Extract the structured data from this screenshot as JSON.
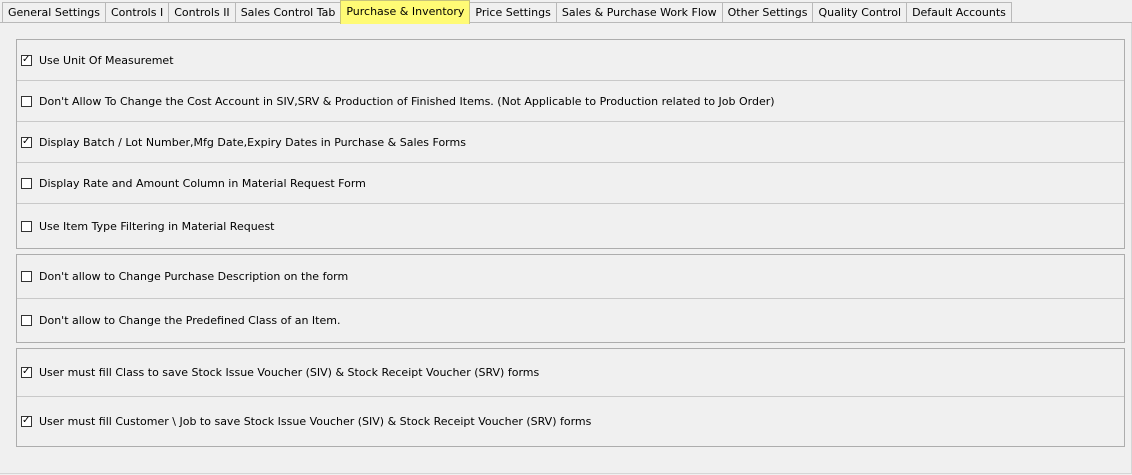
{
  "tabs": [
    {
      "label": "General Settings",
      "active": false
    },
    {
      "label": "Controls I",
      "active": false
    },
    {
      "label": "Controls II",
      "active": false
    },
    {
      "label": "Sales Control Tab",
      "active": false
    },
    {
      "label": "Purchase & Inventory",
      "active": true
    },
    {
      "label": "Price Settings",
      "active": false
    },
    {
      "label": "Sales & Purchase Work Flow",
      "active": false
    },
    {
      "label": "Other Settings",
      "active": false
    },
    {
      "label": "Quality Control",
      "active": false
    },
    {
      "label": "Default Accounts",
      "active": false
    }
  ],
  "group1": [
    {
      "label": "Use Unit Of Measuremet",
      "checked": true
    },
    {
      "label": "Don't Allow To Change the Cost Account in SIV,SRV & Production of Finished Items. (Not Applicable to Production related to Job Order)",
      "checked": false
    },
    {
      "label": "Display Batch / Lot Number,Mfg Date,Expiry Dates in Purchase & Sales Forms",
      "checked": true
    },
    {
      "label": "Display Rate and Amount Column in Material Request Form",
      "checked": false
    },
    {
      "label": "Use Item Type Filtering in Material Request",
      "checked": false
    }
  ],
  "group2": [
    {
      "label": "Don't allow to Change Purchase Description  on the form",
      "checked": false
    },
    {
      "label": "Don't allow to Change the Predefined Class of an Item.",
      "checked": false
    }
  ],
  "group3": [
    {
      "label": "User must fill Class to save Stock Issue Voucher (SIV) & Stock Receipt Voucher (SRV) forms",
      "checked": true
    },
    {
      "label": "User must fill Customer \\ Job to save Stock Issue Voucher (SIV) & Stock Receipt Voucher (SRV) forms",
      "checked": true
    }
  ]
}
